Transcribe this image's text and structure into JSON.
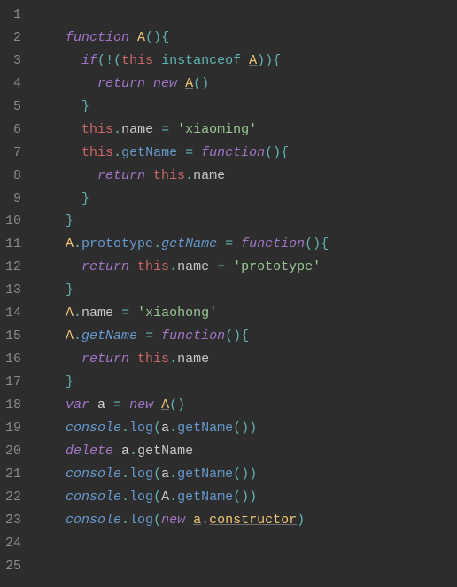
{
  "lines": [
    {
      "n": "1",
      "tokens": []
    },
    {
      "n": "2",
      "tokens": [
        {
          "t": "function ",
          "c": "c-kw"
        },
        {
          "t": "A",
          "c": "c-fn"
        },
        {
          "t": "()",
          "c": "c-punsoft"
        },
        {
          "t": "{",
          "c": "c-punsoft"
        }
      ]
    },
    {
      "n": "3",
      "tokens": [
        {
          "t": "  ",
          "c": ""
        },
        {
          "t": "if",
          "c": "c-kw"
        },
        {
          "t": "(",
          "c": "c-punsoft"
        },
        {
          "t": "!",
          "c": "c-bang"
        },
        {
          "t": "(",
          "c": "c-punsoft"
        },
        {
          "t": "this ",
          "c": "c-this"
        },
        {
          "t": "instanceof ",
          "c": "c-op"
        },
        {
          "t": "A",
          "c": "c-class"
        },
        {
          "t": "))",
          "c": "c-punsoft"
        },
        {
          "t": "{",
          "c": "c-punsoft"
        }
      ]
    },
    {
      "n": "4",
      "tokens": [
        {
          "t": "    ",
          "c": ""
        },
        {
          "t": "return ",
          "c": "c-kw"
        },
        {
          "t": "new ",
          "c": "c-kw"
        },
        {
          "t": "A",
          "c": "c-class"
        },
        {
          "t": "()",
          "c": "c-punsoft"
        }
      ]
    },
    {
      "n": "5",
      "tokens": [
        {
          "t": "  ",
          "c": ""
        },
        {
          "t": "}",
          "c": "c-punsoft"
        }
      ]
    },
    {
      "n": "6",
      "tokens": [
        {
          "t": "  ",
          "c": ""
        },
        {
          "t": "this",
          "c": "c-this"
        },
        {
          "t": ".",
          "c": "c-punsoft"
        },
        {
          "t": "name",
          "c": "c-plain"
        },
        {
          "t": " = ",
          "c": "c-op"
        },
        {
          "t": "'xiaoming'",
          "c": "c-str"
        }
      ]
    },
    {
      "n": "7",
      "tokens": [
        {
          "t": "  ",
          "c": ""
        },
        {
          "t": "this",
          "c": "c-this"
        },
        {
          "t": ".",
          "c": "c-punsoft"
        },
        {
          "t": "getName",
          "c": "c-prop"
        },
        {
          "t": " = ",
          "c": "c-op"
        },
        {
          "t": "function",
          "c": "c-kw"
        },
        {
          "t": "()",
          "c": "c-punsoft"
        },
        {
          "t": "{",
          "c": "c-punsoft"
        }
      ]
    },
    {
      "n": "8",
      "tokens": [
        {
          "t": "    ",
          "c": ""
        },
        {
          "t": "return ",
          "c": "c-kw"
        },
        {
          "t": "this",
          "c": "c-this"
        },
        {
          "t": ".",
          "c": "c-punsoft"
        },
        {
          "t": "name",
          "c": "c-plain"
        }
      ]
    },
    {
      "n": "9",
      "tokens": [
        {
          "t": "  ",
          "c": ""
        },
        {
          "t": "}",
          "c": "c-punsoft"
        }
      ]
    },
    {
      "n": "10",
      "tokens": [
        {
          "t": "}",
          "c": "c-punsoft"
        }
      ]
    },
    {
      "n": "11",
      "tokens": [
        {
          "t": "A",
          "c": "c-fn"
        },
        {
          "t": ".",
          "c": "c-punsoft"
        },
        {
          "t": "prototype",
          "c": "c-prop"
        },
        {
          "t": ".",
          "c": "c-punsoft"
        },
        {
          "t": "getName",
          "c": "c-propit"
        },
        {
          "t": " = ",
          "c": "c-op"
        },
        {
          "t": "function",
          "c": "c-kw"
        },
        {
          "t": "()",
          "c": "c-punsoft"
        },
        {
          "t": "{",
          "c": "c-punsoft"
        }
      ]
    },
    {
      "n": "12",
      "tokens": [
        {
          "t": "  ",
          "c": ""
        },
        {
          "t": "return ",
          "c": "c-kw"
        },
        {
          "t": "this",
          "c": "c-this"
        },
        {
          "t": ".",
          "c": "c-punsoft"
        },
        {
          "t": "name",
          "c": "c-plain"
        },
        {
          "t": " + ",
          "c": "c-op"
        },
        {
          "t": "'prototype'",
          "c": "c-str"
        }
      ]
    },
    {
      "n": "13",
      "tokens": [
        {
          "t": "}",
          "c": "c-punsoft"
        }
      ]
    },
    {
      "n": "14",
      "tokens": [
        {
          "t": "A",
          "c": "c-fn"
        },
        {
          "t": ".",
          "c": "c-punsoft"
        },
        {
          "t": "name",
          "c": "c-plain"
        },
        {
          "t": " = ",
          "c": "c-op"
        },
        {
          "t": "'xiaohong'",
          "c": "c-str"
        }
      ]
    },
    {
      "n": "15",
      "tokens": [
        {
          "t": "A",
          "c": "c-fn"
        },
        {
          "t": ".",
          "c": "c-punsoft"
        },
        {
          "t": "getName",
          "c": "c-propit"
        },
        {
          "t": " = ",
          "c": "c-op"
        },
        {
          "t": "function",
          "c": "c-kw"
        },
        {
          "t": "()",
          "c": "c-punsoft"
        },
        {
          "t": "{",
          "c": "c-punsoft"
        }
      ]
    },
    {
      "n": "16",
      "tokens": [
        {
          "t": "  ",
          "c": ""
        },
        {
          "t": "return ",
          "c": "c-kw"
        },
        {
          "t": "this",
          "c": "c-this"
        },
        {
          "t": ".",
          "c": "c-punsoft"
        },
        {
          "t": "name",
          "c": "c-plain"
        }
      ]
    },
    {
      "n": "17",
      "tokens": [
        {
          "t": "}",
          "c": "c-punsoft"
        }
      ]
    },
    {
      "n": "18",
      "tokens": [
        {
          "t": "var ",
          "c": "c-kw"
        },
        {
          "t": "a",
          "c": "c-id"
        },
        {
          "t": " = ",
          "c": "c-op"
        },
        {
          "t": "new ",
          "c": "c-kw"
        },
        {
          "t": "A",
          "c": "c-class"
        },
        {
          "t": "()",
          "c": "c-punsoft"
        }
      ]
    },
    {
      "n": "19",
      "tokens": [
        {
          "t": "console",
          "c": "c-console"
        },
        {
          "t": ".",
          "c": "c-punsoft"
        },
        {
          "t": "log",
          "c": "c-prop"
        },
        {
          "t": "(",
          "c": "c-punsoft"
        },
        {
          "t": "a",
          "c": "c-id"
        },
        {
          "t": ".",
          "c": "c-punsoft"
        },
        {
          "t": "getName",
          "c": "c-prop"
        },
        {
          "t": "())",
          "c": "c-punsoft"
        }
      ]
    },
    {
      "n": "20",
      "tokens": [
        {
          "t": "delete ",
          "c": "c-kw"
        },
        {
          "t": "a",
          "c": "c-id"
        },
        {
          "t": ".",
          "c": "c-punsoft"
        },
        {
          "t": "getName",
          "c": "c-plain"
        }
      ]
    },
    {
      "n": "21",
      "tokens": [
        {
          "t": "console",
          "c": "c-console"
        },
        {
          "t": ".",
          "c": "c-punsoft"
        },
        {
          "t": "log",
          "c": "c-prop"
        },
        {
          "t": "(",
          "c": "c-punsoft"
        },
        {
          "t": "a",
          "c": "c-id"
        },
        {
          "t": ".",
          "c": "c-punsoft"
        },
        {
          "t": "getName",
          "c": "c-prop"
        },
        {
          "t": "())",
          "c": "c-punsoft"
        }
      ]
    },
    {
      "n": "22",
      "tokens": [
        {
          "t": "console",
          "c": "c-console"
        },
        {
          "t": ".",
          "c": "c-punsoft"
        },
        {
          "t": "log",
          "c": "c-prop"
        },
        {
          "t": "(",
          "c": "c-punsoft"
        },
        {
          "t": "A",
          "c": "c-plain"
        },
        {
          "t": ".",
          "c": "c-punsoft"
        },
        {
          "t": "getName",
          "c": "c-prop"
        },
        {
          "t": "())",
          "c": "c-punsoft"
        }
      ]
    },
    {
      "n": "23",
      "tokens": [
        {
          "t": "console",
          "c": "c-console"
        },
        {
          "t": ".",
          "c": "c-punsoft"
        },
        {
          "t": "log",
          "c": "c-prop"
        },
        {
          "t": "(",
          "c": "c-punsoft"
        },
        {
          "t": "new ",
          "c": "c-kw"
        },
        {
          "t": "a",
          "c": "c-class"
        },
        {
          "t": ".",
          "c": "c-punsoft"
        },
        {
          "t": "constructor",
          "c": "c-constr"
        },
        {
          "t": ")",
          "c": "c-punsoft"
        }
      ]
    },
    {
      "n": "24",
      "tokens": []
    },
    {
      "n": "25",
      "tokens": []
    }
  ]
}
